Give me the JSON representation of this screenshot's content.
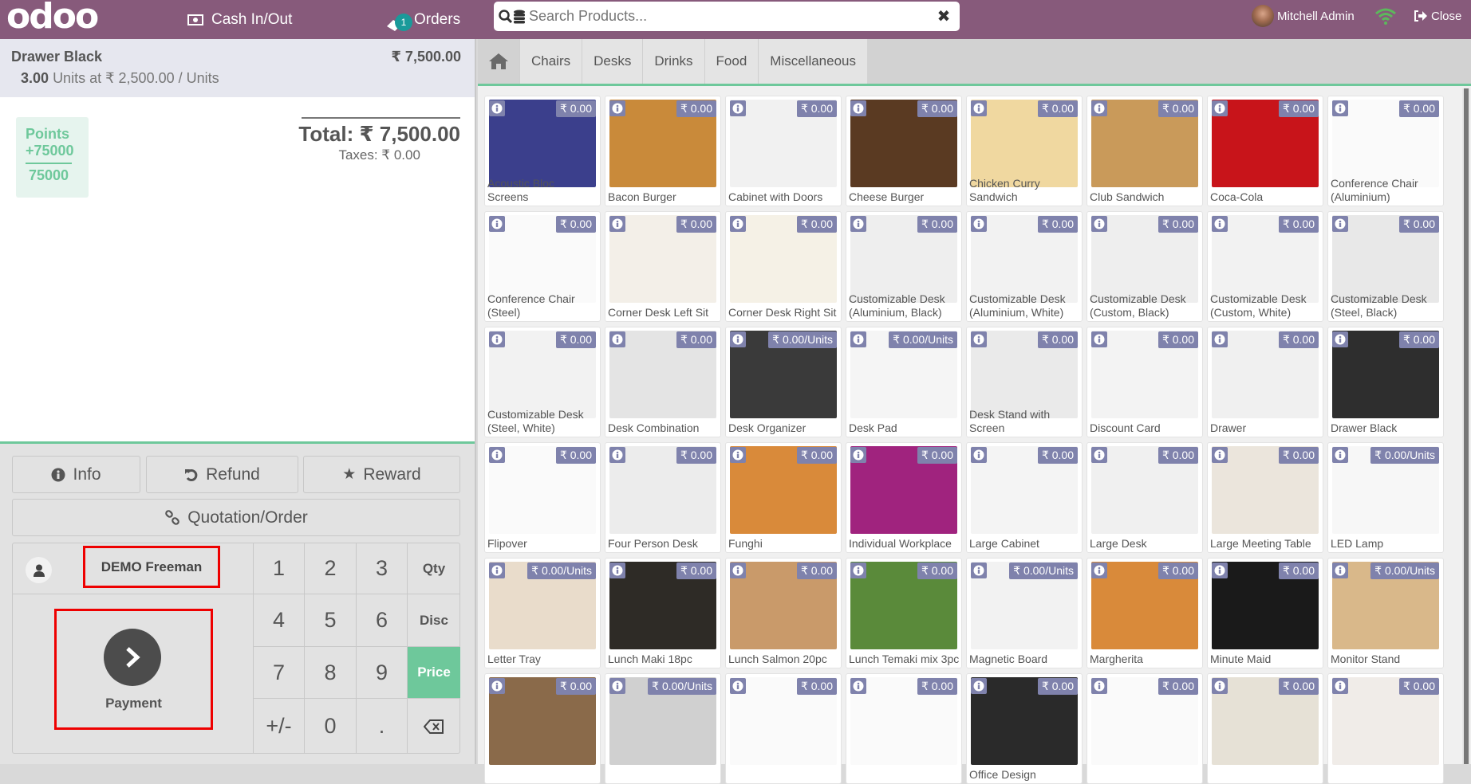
{
  "header": {
    "logo": "odoo",
    "cash_label": "Cash In/Out",
    "orders_label": "Orders",
    "orders_count": "1",
    "search_placeholder": "Search Products...",
    "search_value": "",
    "user_name": "Mitchell Admin",
    "close_label": "Close",
    "brand_color": "#875a7b"
  },
  "order": {
    "line": {
      "product": "Drawer Black",
      "price": "₹ 7,500.00",
      "qty": "3.00",
      "detail": "Units at ₹ 2,500.00 / Units"
    },
    "points": {
      "label": "Points",
      "won": "+75000",
      "total": "75000"
    },
    "total": "Total: ₹ 7,500.00",
    "taxes": "Taxes: ₹ 0.00"
  },
  "controls": {
    "info": "Info",
    "refund": "Refund",
    "reward": "Reward",
    "quotation": "Quotation/Order",
    "customer": "DEMO Freeman",
    "payment": "Payment",
    "keys": [
      "1",
      "2",
      "3",
      "Qty",
      "4",
      "5",
      "6",
      "Disc",
      "7",
      "8",
      "9",
      "Price",
      "+/-",
      "0",
      "."
    ],
    "active_mode": "Price",
    "accent_color": "#6ec89b"
  },
  "categories": [
    "Chairs",
    "Desks",
    "Drinks",
    "Food",
    "Miscellaneous"
  ],
  "products": [
    {
      "name": "Acoustic Bloc Screens",
      "price": "₹ 0.00",
      "img": "#3b3f8c"
    },
    {
      "name": "Bacon Burger",
      "price": "₹ 0.00",
      "img": "#c98a3a"
    },
    {
      "name": "Cabinet with Doors",
      "price": "₹ 0.00",
      "img": "#f1f1f1"
    },
    {
      "name": "Cheese Burger",
      "price": "₹ 0.00",
      "img": "#5a3a22"
    },
    {
      "name": "Chicken Curry Sandwich",
      "price": "₹ 0.00",
      "img": "#f0d8a0"
    },
    {
      "name": "Club Sandwich",
      "price": "₹ 0.00",
      "img": "#c99a5a"
    },
    {
      "name": "Coca-Cola",
      "price": "₹ 0.00",
      "img": "#c8141a"
    },
    {
      "name": "Conference Chair (Aluminium)",
      "price": "₹ 0.00",
      "img": "#fafafa"
    },
    {
      "name": "Conference Chair (Steel)",
      "price": "₹ 0.00",
      "img": "#fafafa"
    },
    {
      "name": "Corner Desk Left Sit",
      "price": "₹ 0.00",
      "img": "#f3efe8"
    },
    {
      "name": "Corner Desk Right Sit",
      "price": "₹ 0.00",
      "img": "#f5f1e6"
    },
    {
      "name": "Customizable Desk (Aluminium, Black)",
      "price": "₹ 0.00",
      "img": "#eeeeee"
    },
    {
      "name": "Customizable Desk (Aluminium, White)",
      "price": "₹ 0.00",
      "img": "#f2f2f2"
    },
    {
      "name": "Customizable Desk (Custom, Black)",
      "price": "₹ 0.00",
      "img": "#eeeeee"
    },
    {
      "name": "Customizable Desk (Custom, White)",
      "price": "₹ 0.00",
      "img": "#f2f2f2"
    },
    {
      "name": "Customizable Desk (Steel, Black)",
      "price": "₹ 0.00",
      "img": "#e8e8e8"
    },
    {
      "name": "Customizable Desk (Steel, White)",
      "price": "₹ 0.00",
      "img": "#f2f2f2"
    },
    {
      "name": "Desk Combination",
      "price": "₹ 0.00",
      "img": "#e4e4e4"
    },
    {
      "name": "Desk Organizer",
      "price": "₹ 0.00/Units",
      "img": "#3a3a3a"
    },
    {
      "name": "Desk Pad",
      "price": "₹ 0.00/Units",
      "img": "#f5f5f5"
    },
    {
      "name": "Desk Stand with Screen",
      "price": "₹ 0.00",
      "img": "#eaeaea"
    },
    {
      "name": "Discount Card",
      "price": "₹ 0.00",
      "img": "#f3f3f3"
    },
    {
      "name": "Drawer",
      "price": "₹ 0.00",
      "img": "#f0f0f0"
    },
    {
      "name": "Drawer Black",
      "price": "₹ 0.00",
      "img": "#2e2e2e"
    },
    {
      "name": "Flipover",
      "price": "₹ 0.00",
      "img": "#fafafa"
    },
    {
      "name": "Four Person Desk",
      "price": "₹ 0.00",
      "img": "#ececec"
    },
    {
      "name": "Funghi",
      "price": "₹ 0.00",
      "img": "#d98a3a"
    },
    {
      "name": "Individual Workplace",
      "price": "₹ 0.00",
      "img": "#a0237e"
    },
    {
      "name": "Large Cabinet",
      "price": "₹ 0.00",
      "img": "#f4f4f4"
    },
    {
      "name": "Large Desk",
      "price": "₹ 0.00",
      "img": "#f0f0f0"
    },
    {
      "name": "Large Meeting Table",
      "price": "₹ 0.00",
      "img": "#ebe5dc"
    },
    {
      "name": "LED Lamp",
      "price": "₹ 0.00/Units",
      "img": "#f7f7f7"
    },
    {
      "name": "Letter Tray",
      "price": "₹ 0.00/Units",
      "img": "#e9dccb"
    },
    {
      "name": "Lunch Maki 18pc",
      "price": "₹ 0.00",
      "img": "#2e2b26"
    },
    {
      "name": "Lunch Salmon 20pc",
      "price": "₹ 0.00",
      "img": "#c99a6a"
    },
    {
      "name": "Lunch Temaki mix 3pc",
      "price": "₹ 0.00",
      "img": "#5a8a3a"
    },
    {
      "name": "Magnetic Board",
      "price": "₹ 0.00/Units",
      "img": "#f2f2f2"
    },
    {
      "name": "Margherita",
      "price": "₹ 0.00",
      "img": "#d98a3a"
    },
    {
      "name": "Minute Maid",
      "price": "₹ 0.00",
      "img": "#1a1a1a"
    },
    {
      "name": "Monitor Stand",
      "price": "₹ 0.00/Units",
      "img": "#d9b88a"
    },
    {
      "name": "",
      "price": "₹ 0.00",
      "img": "#8a6a4a"
    },
    {
      "name": "",
      "price": "₹ 0.00/Units",
      "img": "#d0d0d0"
    },
    {
      "name": "",
      "price": "₹ 0.00",
      "img": "#fafafa"
    },
    {
      "name": "",
      "price": "₹ 0.00",
      "img": "#fafafa"
    },
    {
      "name": "Office Design",
      "price": "₹ 0.00",
      "img": "#2a2a2a"
    },
    {
      "name": "",
      "price": "₹ 0.00",
      "img": "#fafafa"
    },
    {
      "name": "",
      "price": "₹ 0.00",
      "img": "#e6e1d6"
    },
    {
      "name": "",
      "price": "₹ 0.00",
      "img": "#f0ece8"
    }
  ]
}
